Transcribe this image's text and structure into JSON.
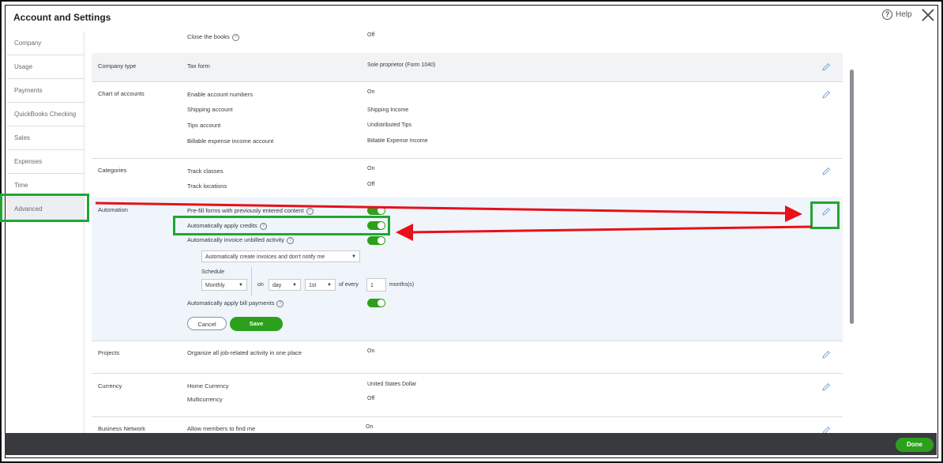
{
  "header": {
    "title": "Account and Settings",
    "help_label": "Help"
  },
  "sidebar": {
    "items": [
      {
        "label": "Company"
      },
      {
        "label": "Usage"
      },
      {
        "label": "Payments"
      },
      {
        "label": "QuickBooks Checking"
      },
      {
        "label": "Sales"
      },
      {
        "label": "Expenses"
      },
      {
        "label": "Time"
      },
      {
        "label": "Advanced"
      }
    ]
  },
  "rows": {
    "close_books": {
      "label": "Close the books",
      "value": "Off"
    },
    "company_type": {
      "category": "Company type",
      "label": "Tax form",
      "value": "Sole proprietor (Form 1040)"
    },
    "chart_of_accounts": {
      "category": "Chart of accounts",
      "items": [
        {
          "label": "Enable account numbers",
          "value": "On"
        },
        {
          "label": "Shipping account",
          "value": "Shipping Income"
        },
        {
          "label": "Tips account",
          "value": "Undistributed Tips"
        },
        {
          "label": "Billable expense income account",
          "value": "Billable Expense Income"
        }
      ]
    },
    "categories": {
      "category": "Categories",
      "items": [
        {
          "label": "Track classes",
          "value": "On"
        },
        {
          "label": "Track locations",
          "value": "Off"
        }
      ]
    },
    "automation": {
      "category": "Automation",
      "prefill_label": "Pre-fill forms with previously entered content",
      "apply_credits_label": "Automatically apply credits",
      "invoice_unbilled_label": "Automatically invoice unbilled activity",
      "invoice_option": "Automatically create invoices and don't notify me",
      "schedule_label": "Schedule",
      "frequency": "Monthly",
      "on_label": "on",
      "day_option": "day",
      "day_number": "1st",
      "of_every_label": "of every",
      "months_value": "1",
      "months_label": "months(s)",
      "bill_payments_label": "Automatically apply bill payments",
      "cancel_label": "Cancel",
      "save_label": "Save"
    },
    "projects": {
      "category": "Projects",
      "label": "Organize all job-related activity in one place",
      "value": "On"
    },
    "currency": {
      "category": "Currency",
      "items": [
        {
          "label": "Home Currency",
          "value": "United States Dollar"
        },
        {
          "label": "Multicurrency",
          "value": "Off"
        }
      ]
    },
    "business_network": {
      "category": "Business Network",
      "label": "Allow members to find me",
      "value": "On"
    }
  },
  "footer": {
    "done_label": "Done"
  },
  "colors": {
    "accent_green": "#2ca01c",
    "annotation_green": "#1fa633",
    "annotation_red": "#e8101a"
  }
}
